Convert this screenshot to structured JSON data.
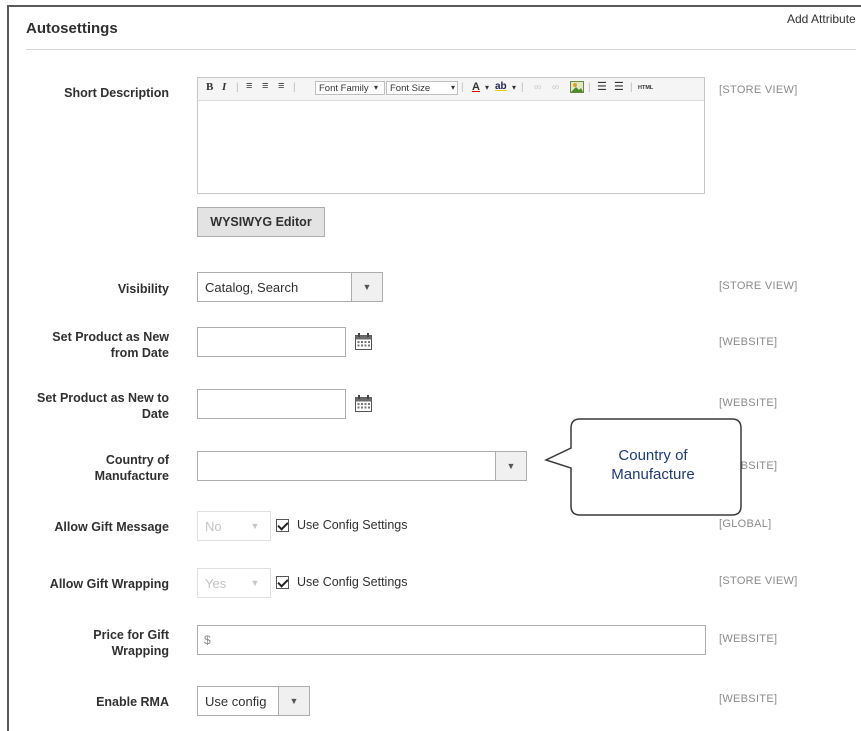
{
  "section": {
    "title": "Autosettings",
    "add_attribute": "Add Attribute"
  },
  "short_description": {
    "label": "Short Description",
    "scope": "[STORE VIEW]",
    "toolbar": {
      "bold": "B",
      "italic": "I",
      "font_family": "Font Family",
      "font_size": "Font Size",
      "text_color": "A",
      "highlight": "ab",
      "html": "HTML"
    },
    "button_label": "WYSIWYG Editor"
  },
  "visibility": {
    "label": "Visibility",
    "value": "Catalog, Search",
    "scope": "[STORE VIEW]"
  },
  "new_from": {
    "label_line1": "Set Product as New",
    "label_line2": "from Date",
    "value": "",
    "scope": "[WEBSITE]"
  },
  "new_to": {
    "label_line1": "Set Product as New to",
    "label_line2": "Date",
    "value": "",
    "scope": "[WEBSITE]"
  },
  "country": {
    "label_line1": "Country of",
    "label_line2": "Manufacture",
    "value": "",
    "scope": "[WEBSITE]"
  },
  "gift_message": {
    "label": "Allow Gift Message",
    "value": "No",
    "checkbox_label": "Use Config Settings",
    "checked": true,
    "scope": "[GLOBAL]"
  },
  "gift_wrapping": {
    "label": "Allow Gift Wrapping",
    "value": "Yes",
    "checkbox_label": "Use Config Settings",
    "checked": true,
    "scope": "[STORE VIEW]"
  },
  "gift_wrap_price": {
    "label_line1": "Price for Gift",
    "label_line2": "Wrapping",
    "prefix": "$",
    "value": "",
    "scope": "[WEBSITE]"
  },
  "rma": {
    "label": "Enable RMA",
    "value": "Use config",
    "scope": "[WEBSITE]"
  },
  "callout": {
    "line1": "Country of",
    "line2": "Manufacture"
  }
}
